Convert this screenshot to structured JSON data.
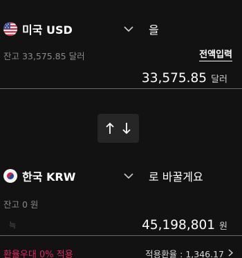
{
  "from": {
    "flag": "us-flag-icon",
    "name": "미국 USD",
    "suffix": "을",
    "balance_text": "잔고 33,575.85 달러",
    "full_input_label": "전액입력",
    "amount": "33,575.85",
    "unit": "달러"
  },
  "swap": {
    "icon": "swap-arrows-icon"
  },
  "to": {
    "flag": "kr-flag-icon",
    "name": "한국 KRW",
    "suffix": "로 바꿀게요",
    "balance_text": "잔고 0 원",
    "hint": "늑",
    "amount": "45,198,801",
    "unit": "원"
  },
  "footer": {
    "preferential": "환율우대 0% 적용",
    "rate_label": "적용환율 : 1,346.17"
  },
  "colors": {
    "background": "#121212",
    "accent_red": "#e0245e",
    "muted": "#8a8a8a",
    "divider": "#6a6a6a"
  }
}
